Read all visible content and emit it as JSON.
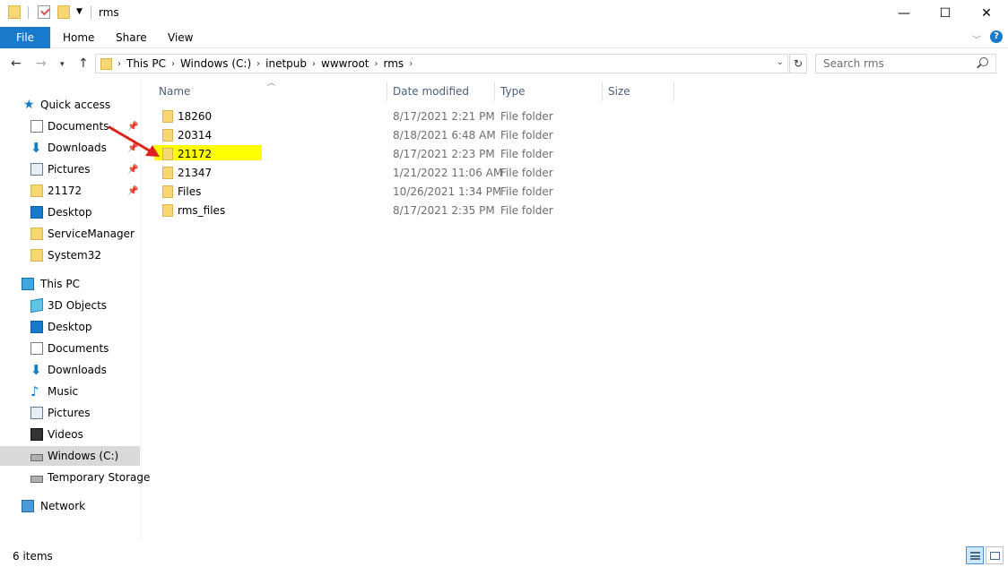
{
  "window": {
    "title": "rms",
    "controls": {
      "minimize": "—",
      "maximize": "☐",
      "close": "✕"
    }
  },
  "ribbon": {
    "tabs": [
      "File",
      "Home",
      "Share",
      "View"
    ]
  },
  "address": {
    "breadcrumbs": [
      "This PC",
      "Windows (C:)",
      "inetpub",
      "wwwroot",
      "rms"
    ]
  },
  "search": {
    "placeholder": "Search rms"
  },
  "sidebar": {
    "quick_access_label": "Quick access",
    "quick_access": [
      {
        "label": "Documents",
        "icon": "documents-icon",
        "pinned": true
      },
      {
        "label": "Downloads",
        "icon": "downloads-icon",
        "pinned": true
      },
      {
        "label": "Pictures",
        "icon": "pictures-icon",
        "pinned": true
      },
      {
        "label": "21172",
        "icon": "folder-icon",
        "pinned": true
      },
      {
        "label": "Desktop",
        "icon": "desktop-icon",
        "pinned": false
      },
      {
        "label": "ServiceManager",
        "icon": "folder-icon",
        "pinned": false
      },
      {
        "label": "System32",
        "icon": "folder-icon",
        "pinned": false
      }
    ],
    "this_pc_label": "This PC",
    "this_pc": [
      {
        "label": "3D Objects",
        "icon": "3d-objects-icon"
      },
      {
        "label": "Desktop",
        "icon": "desktop-icon"
      },
      {
        "label": "Documents",
        "icon": "documents-icon"
      },
      {
        "label": "Downloads",
        "icon": "downloads-icon"
      },
      {
        "label": "Music",
        "icon": "music-icon"
      },
      {
        "label": "Pictures",
        "icon": "pictures-icon"
      },
      {
        "label": "Videos",
        "icon": "videos-icon"
      },
      {
        "label": "Windows (C:)",
        "icon": "drive-icon",
        "selected": true
      },
      {
        "label": "Temporary Storage",
        "icon": "drive-icon"
      }
    ],
    "network_label": "Network"
  },
  "columns": [
    "Name",
    "Date modified",
    "Type",
    "Size"
  ],
  "files": [
    {
      "name": "18260",
      "date": "8/17/2021 2:21 PM",
      "type": "File folder",
      "size": ""
    },
    {
      "name": "20314",
      "date": "8/18/2021 6:48 AM",
      "type": "File folder",
      "size": ""
    },
    {
      "name": "21172",
      "date": "8/17/2021 2:23 PM",
      "type": "File folder",
      "size": "",
      "highlighted": true
    },
    {
      "name": "21347",
      "date": "1/21/2022 11:06 AM",
      "type": "File folder",
      "size": ""
    },
    {
      "name": "Files",
      "date": "10/26/2021 1:34 PM",
      "type": "File folder",
      "size": ""
    },
    {
      "name": "rms_files",
      "date": "8/17/2021 2:35 PM",
      "type": "File folder",
      "size": ""
    }
  ],
  "status": {
    "item_count": "6 items"
  },
  "colors": {
    "accent": "#1979ca",
    "highlight": "#ffff00",
    "arrow": "#e0201c",
    "selected_nav": "#d9d9d9"
  }
}
